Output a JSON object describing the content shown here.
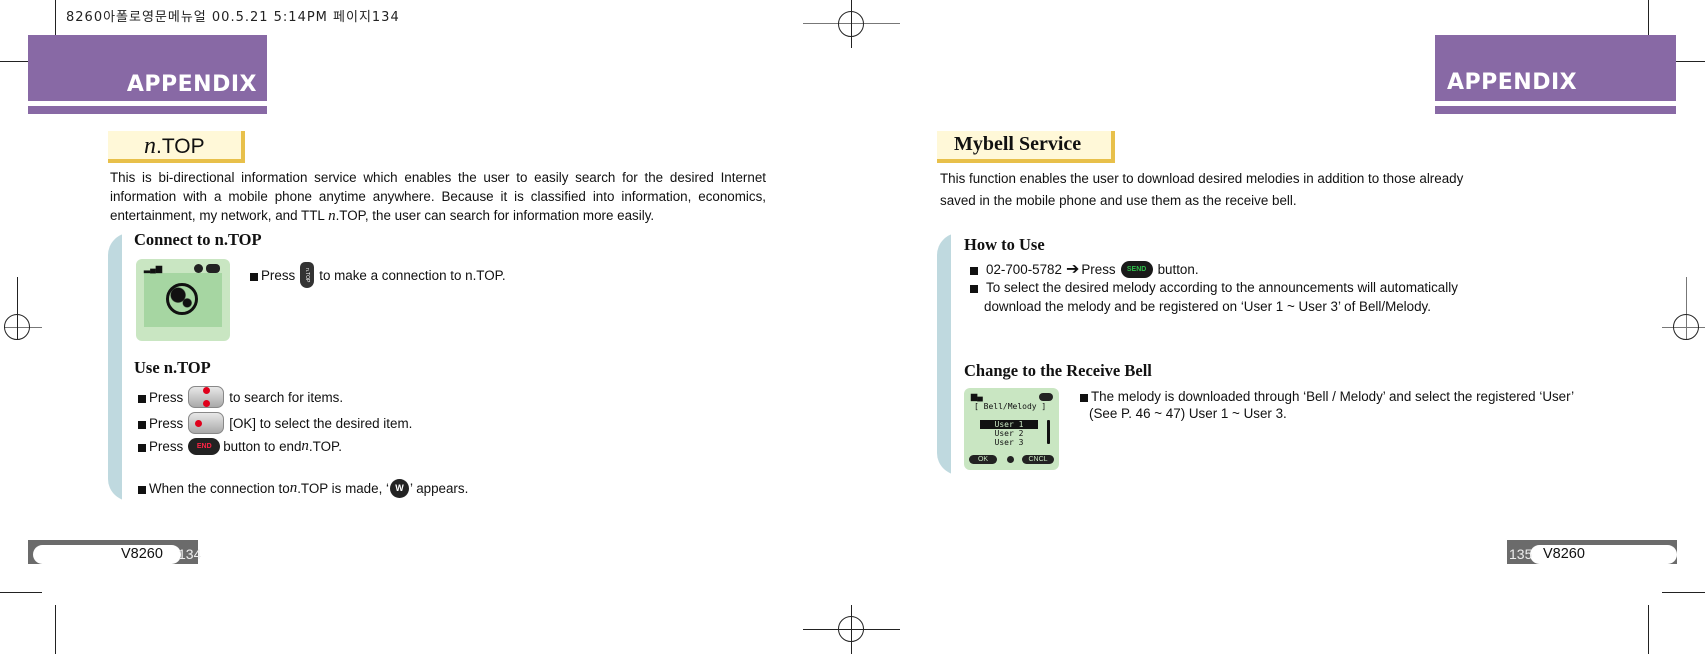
{
  "print_slug": "8260아폴로영문메뉴얼   00.5.21 5:14PM 페이지134",
  "left_page": {
    "header": {
      "label": "APPENDIX"
    },
    "section_title": {
      "prefix": "n",
      "suffix": ".TOP"
    },
    "intro": {
      "part1": "This is bi-directional information service which enables the user to easily search for the desired Internet information with a mobile phone anytime anywhere. Because it is classified into information, economics, entertainment, my network, and TTL ",
      "part1_italic": "n",
      "part2": ".TOP, the user can search for information more easily."
    },
    "connect": {
      "heading": "Connect to n.TOP",
      "screen_icon": "globe-icon",
      "line": {
        "before": "Press",
        "key_icon": "ntop-key-icon",
        "key_text": "n.TOP",
        "after": "to make a connection to n.TOP."
      }
    },
    "use": {
      "heading": "Use n.TOP",
      "lines": [
        {
          "before": "Press",
          "key_icon": "nav-key-updown-icon",
          "after": "to search for items."
        },
        {
          "before": "Press",
          "key_icon": "nav-key-ok-icon",
          "after": "[OK] to select the desired item."
        },
        {
          "before": "Press",
          "key_icon": "end-key-icon",
          "key_text": "END",
          "after_1": "button to end ",
          "after_italic": "n",
          "after_2": ".TOP."
        }
      ],
      "note": {
        "before_1": "When the connection to ",
        "before_italic": "n",
        "before_2": ".TOP is made, ‘",
        "icon": "ntop-indicator-icon",
        "icon_text": "W",
        "after": "’ appears."
      }
    },
    "footer": {
      "model": "V8260",
      "page": "134"
    }
  },
  "right_page": {
    "header": {
      "label": "APPENDIX"
    },
    "section_title": "Mybell Service",
    "intro": {
      "line1": "This function enables the user to download desired melodies in addition to those already",
      "line2": "saved in the mobile phone and use them as the receive bell."
    },
    "how_to_use": {
      "heading": "How to Use",
      "line1": {
        "number": "02-700-5782",
        "arrow_icon": "arrow-right-icon",
        "before": "Press",
        "key_icon": "send-key-icon",
        "key_text": "SEND",
        "after": "button."
      },
      "line2a": "To select the desired melody  according to the announcements will automatically",
      "line2b": "download the melody and be registered on ‘User 1 ~ User 3’ of Bell/Melody."
    },
    "change_bell": {
      "heading": "Change to the Receive Bell",
      "screen": {
        "title": "[ Bell/Melody ]",
        "items": [
          "User 1",
          "User 2",
          "User 3"
        ],
        "selected_index": 0,
        "softkey_left": "OK",
        "softkey_right": "CNCL"
      },
      "line1": "The melody  is downloaded  through ‘Bell / Melody’ and select  the registered  ‘User’",
      "line2": "(See P. 46 ~ 47) User 1 ~ User 3."
    },
    "footer": {
      "model": "V8260",
      "page": "135"
    }
  },
  "colors": {
    "appendix_purple": "#8869a5",
    "title_box_fill": "#fff8d8",
    "title_box_shadow": "#e8c04a",
    "panel_blue": "#bfd9df",
    "screen_green": "#c9e6c2",
    "footer_gray": "#6b6b6b"
  }
}
